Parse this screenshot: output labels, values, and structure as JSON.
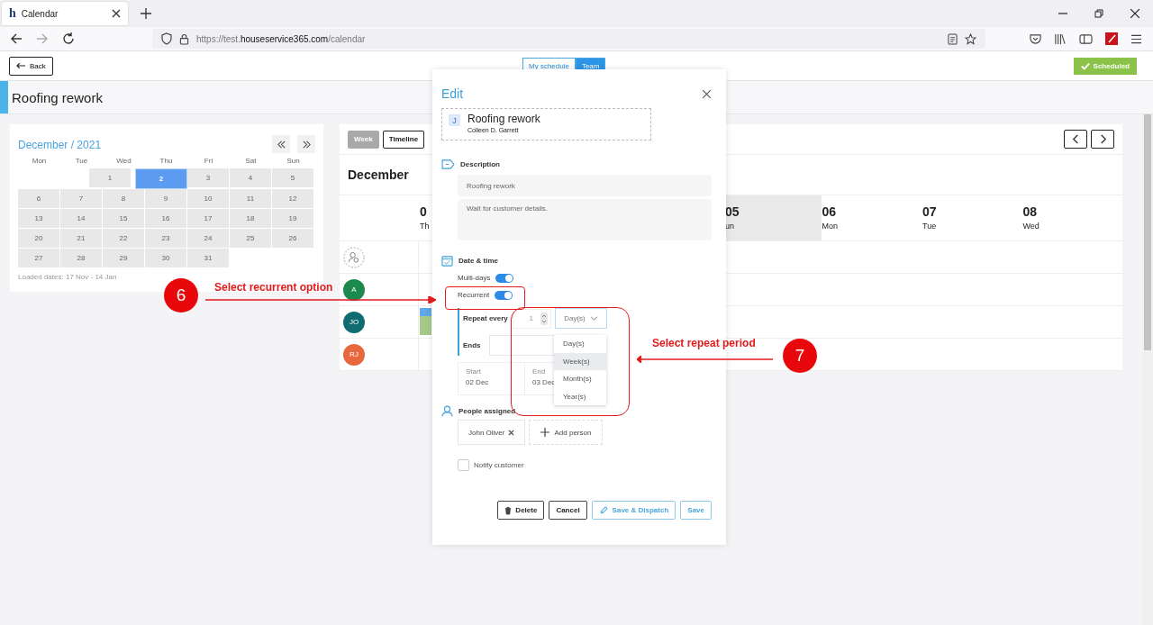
{
  "browser": {
    "tab": {
      "favicon": "h",
      "title": "Calendar"
    },
    "url": {
      "scheme": "https://test.",
      "domain": "houseservice365.com",
      "path": "/calendar"
    }
  },
  "header": {
    "back": "Back",
    "view_toggle": [
      {
        "label": "My schedule",
        "selected": false
      },
      {
        "label": "Team",
        "selected": true
      }
    ],
    "status": "Scheduled"
  },
  "page_title": "Roofing rework",
  "mini_calendar": {
    "title": "December / 2021",
    "weekdays": [
      "Mon",
      "Tue",
      "Wed",
      "Thu",
      "Fri",
      "Sat",
      "Sun"
    ],
    "weeks": [
      [
        {
          "day": "1",
          "selected": false
        },
        {
          "day": "2",
          "selected": true
        },
        {
          "day": "3",
          "selected": false
        },
        {
          "day": "4",
          "selected": false
        },
        {
          "day": "5",
          "selected": false
        }
      ],
      [
        {
          "day": "6",
          "selected": false
        },
        {
          "day": "7",
          "selected": false
        },
        {
          "day": "8",
          "selected": false
        },
        {
          "day": "9",
          "selected": false
        },
        {
          "day": "10",
          "selected": false
        },
        {
          "day": "11",
          "selected": false
        },
        {
          "day": "12",
          "selected": false
        }
      ],
      [
        {
          "day": "13",
          "selected": false
        },
        {
          "day": "14",
          "selected": false
        },
        {
          "day": "15",
          "selected": false
        },
        {
          "day": "16",
          "selected": false
        },
        {
          "day": "17",
          "selected": false
        },
        {
          "day": "18",
          "selected": false
        },
        {
          "day": "19",
          "selected": false
        }
      ],
      [
        {
          "day": "20",
          "selected": false
        },
        {
          "day": "21",
          "selected": false
        },
        {
          "day": "22",
          "selected": false
        },
        {
          "day": "23",
          "selected": false
        },
        {
          "day": "24",
          "selected": false
        },
        {
          "day": "25",
          "selected": false
        },
        {
          "day": "26",
          "selected": false
        }
      ],
      [
        {
          "day": "27",
          "selected": false
        },
        {
          "day": "28",
          "selected": false
        },
        {
          "day": "29",
          "selected": false
        },
        {
          "day": "30",
          "selected": false
        },
        {
          "day": "31",
          "selected": false
        }
      ]
    ],
    "loaded": "Loaded dates: 17 Nov - 14 Jan"
  },
  "timeline": {
    "view_tabs": [
      {
        "label": "Week",
        "selected": false
      },
      {
        "label": "Timeline",
        "selected": true
      }
    ],
    "month": "December",
    "days": [
      {
        "number": "0",
        "weekday": "Th",
        "highlighted": false
      },
      {
        "number": "05",
        "weekday": "un",
        "highlighted": true
      },
      {
        "number": "06",
        "weekday": "Mon",
        "highlighted": false
      },
      {
        "number": "07",
        "weekday": "Tue",
        "highlighted": false
      },
      {
        "number": "08",
        "weekday": "Wed",
        "highlighted": false
      }
    ],
    "people": [
      {
        "kind": "unassigned",
        "event": false
      },
      {
        "kind": "person",
        "initials": "A",
        "color": "#1b8a4c",
        "event": false
      },
      {
        "kind": "person",
        "initials": "JO",
        "color": "#0f6d72",
        "event": true
      },
      {
        "kind": "person",
        "initials": "RJ",
        "color": "#e8683d",
        "event": false
      }
    ]
  },
  "modal": {
    "title": "Edit",
    "job": {
      "badge": "J",
      "title": "Roofing rework",
      "customer": "Colleen D. Garrett"
    },
    "description": {
      "label": "Description",
      "title_value": "Roofing rework",
      "notes_value": "Wait for customer details."
    },
    "date_time": {
      "label": "Date & time",
      "toggles": [
        {
          "label": "Multi-days",
          "on": true
        },
        {
          "label": "Recurrent",
          "on": true
        }
      ],
      "repeat_label": "Repeat every",
      "repeat_count": "1",
      "period": "Day(s)",
      "period_options": [
        {
          "label": "Day(s)",
          "selected": false
        },
        {
          "label": "Week(s)",
          "selected": true
        },
        {
          "label": "Month(s)",
          "selected": false
        },
        {
          "label": "Year(s)",
          "selected": false
        }
      ],
      "ends_label": "Ends",
      "start": {
        "label": "Start",
        "value": "02 Dec"
      },
      "end": {
        "label": "End",
        "value": "03 Dec"
      }
    },
    "people": {
      "label": "People assigned",
      "chips": [
        "John Oliver"
      ],
      "add": "Add person"
    },
    "notify": {
      "label": "Notify customer",
      "checked": false
    },
    "buttons": [
      {
        "kind": "delete",
        "label": "Delete"
      },
      {
        "kind": "cancel",
        "label": "Cancel"
      },
      {
        "kind": "dispatch",
        "label": "Save & Dispatch"
      },
      {
        "kind": "save",
        "label": "Save"
      }
    ]
  },
  "annotations": [
    {
      "number": "6",
      "text": "Select recurrent option"
    },
    {
      "number": "7",
      "text": "Select repeat period"
    }
  ]
}
